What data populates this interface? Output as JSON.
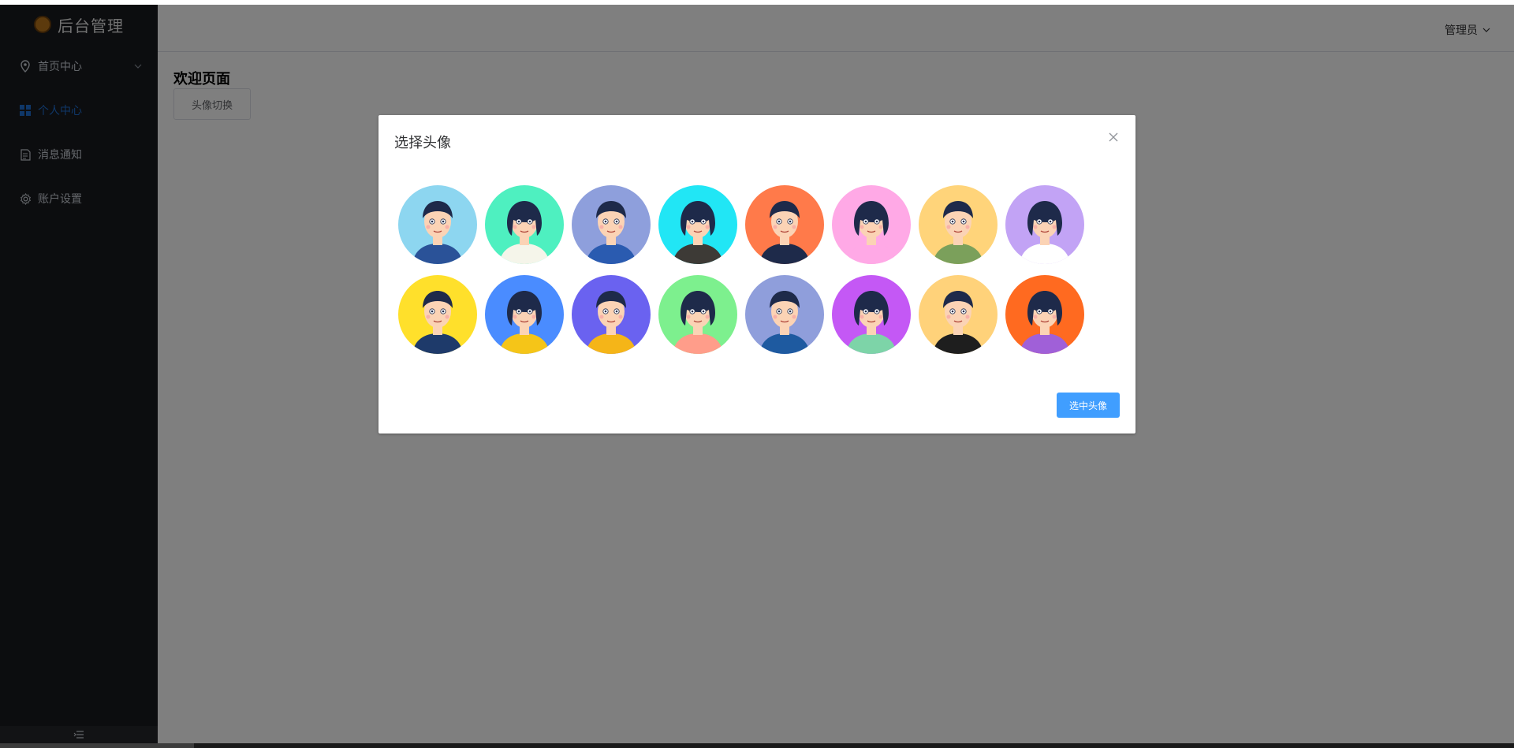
{
  "app": {
    "logo_text": "后台管理"
  },
  "sidebar": {
    "items": [
      {
        "label": "首页中心",
        "icon": "location-icon",
        "has_submenu": true
      },
      {
        "label": "个人中心",
        "icon": "grid-icon",
        "active": true
      },
      {
        "label": "消息通知",
        "icon": "document-icon"
      },
      {
        "label": "账户设置",
        "icon": "gear-icon"
      }
    ],
    "collapse_icon": "menu-collapse-icon"
  },
  "header": {
    "user_label": "管理员",
    "dropdown_icon": "chevron-down-icon"
  },
  "main": {
    "title": "欢迎页面",
    "switch_button_label": "头像切换"
  },
  "dialog": {
    "title": "选择头像",
    "close_icon": "close-icon",
    "confirm_label": "选中头像",
    "avatars": [
      {
        "bg": "#8dd6f0",
        "skin": "#fbd3b5",
        "hair": "#1e2a4a",
        "shirt": "#2a5298"
      },
      {
        "bg": "#4ef0c0",
        "skin": "#fbd3b5",
        "hair": "#1e2a4a",
        "shirt": "#f5f5ea"
      },
      {
        "bg": "#8e9fdc",
        "skin": "#fbd3b5",
        "hair": "#1e2a4a",
        "shirt": "#2a5bb0"
      },
      {
        "bg": "#21e6f5",
        "skin": "#fbd3b5",
        "hair": "#1e2a4a",
        "shirt": "#3d3a36"
      },
      {
        "bg": "#ff7a4a",
        "skin": "#fbd3b5",
        "hair": "#1e2a4a",
        "shirt": "#1e2a4a"
      },
      {
        "bg": "#ffa9e6",
        "skin": "#fbd3b5",
        "hair": "#1e2a4a",
        "shirt": "#ffa9e6"
      },
      {
        "bg": "#ffd47a",
        "skin": "#fbd3b5",
        "hair": "#1e2a4a",
        "shirt": "#7ba05b"
      },
      {
        "bg": "#c2a3f5",
        "skin": "#fbd3b5",
        "hair": "#1e2a4a",
        "shirt": "#ffffff"
      },
      {
        "bg": "#ffe02b",
        "skin": "#fbd3b5",
        "hair": "#1e2a4a",
        "shirt": "#1e3a6a"
      },
      {
        "bg": "#4a8cff",
        "skin": "#fbd3b5",
        "hair": "#1e2a4a",
        "shirt": "#f5c518"
      },
      {
        "bg": "#6a62f0",
        "skin": "#fbd3b5",
        "hair": "#1e2a4a",
        "shirt": "#f5b518"
      },
      {
        "bg": "#7df08e",
        "skin": "#fbd3b5",
        "hair": "#1e2a4a",
        "shirt": "#ff9d8a"
      },
      {
        "bg": "#8f9edb",
        "skin": "#fbd3b5",
        "hair": "#1e2a4a",
        "shirt": "#1e5aa0"
      },
      {
        "bg": "#c458f5",
        "skin": "#fbd3b5",
        "hair": "#1e2a4a",
        "shirt": "#7dd4a8"
      },
      {
        "bg": "#ffd27a",
        "skin": "#fbd3b5",
        "hair": "#1e2a4a",
        "shirt": "#1e1e1e"
      },
      {
        "bg": "#ff6a20",
        "skin": "#fbd3b5",
        "hair": "#1e2a4a",
        "shirt": "#a060d8"
      }
    ]
  },
  "colors": {
    "sidebar_bg": "#191a1f",
    "active": "#1f6fd1",
    "primary": "#409eff"
  }
}
